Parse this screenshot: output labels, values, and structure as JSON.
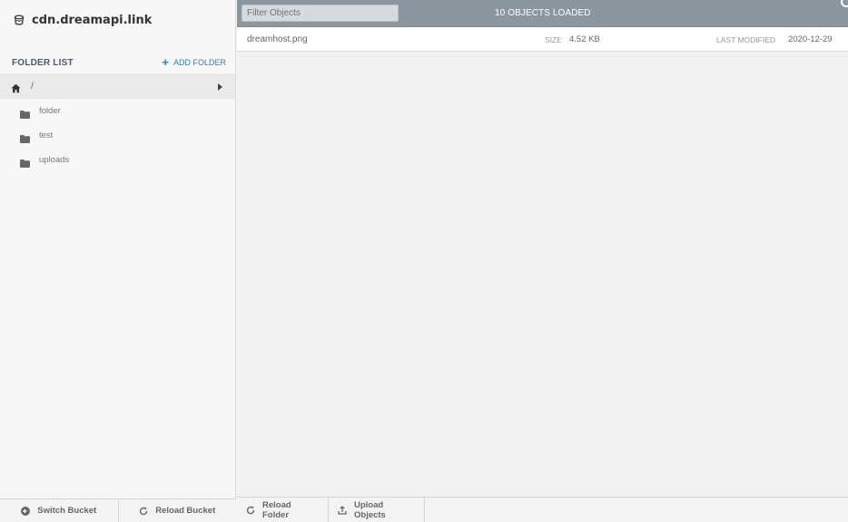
{
  "brand": {
    "name": "cdn.dreamapi.link",
    "icon": "bucket-icon"
  },
  "sidebar": {
    "folder_list_title": "FOLDER LIST",
    "add_folder_label": "ADD FOLDER",
    "root": {
      "label": "/",
      "icon": "home-icon"
    },
    "folders": [
      {
        "label": "folder",
        "icon": "folder-icon"
      },
      {
        "label": "test",
        "icon": "folder-icon"
      },
      {
        "label": "uploads",
        "icon": "folder-icon"
      }
    ],
    "footer": {
      "switch_bucket": "Switch Bucket",
      "reload_bucket": "Reload Bucket"
    }
  },
  "topbar": {
    "filter_placeholder": "Filter Objects",
    "loaded_status": "10 OBJECTS LOADED"
  },
  "files": [
    {
      "name": "dreamhost.png",
      "size_label": "SIZE",
      "size": "4.52 KB",
      "modified_label": "LAST MODIFIED",
      "modified": "2020-12-29"
    }
  ],
  "main_footer": {
    "reload_folder": "Reload Folder",
    "upload_objects": "Upload Objects"
  },
  "colors": {
    "accent": "#2c7ec9",
    "topbar": "#8c969f",
    "sidebar_bg": "#f7f7f7"
  }
}
